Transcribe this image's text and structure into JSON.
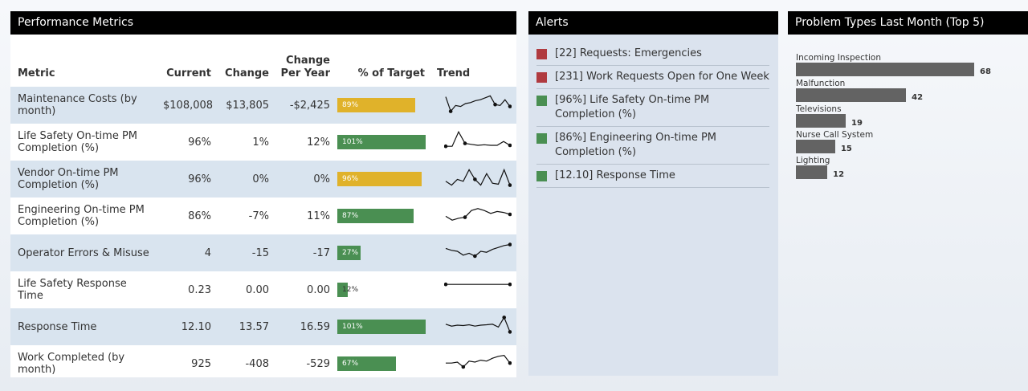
{
  "performance": {
    "title": "Performance Metrics",
    "columns": {
      "metric": "Metric",
      "current": "Current",
      "change": "Change",
      "change_per_year": "Change Per Year",
      "pct_target": "% of Target",
      "trend": "Trend"
    },
    "rows": [
      {
        "metric": "Maintenance Costs (by month)",
        "current": "$108,008",
        "change": "$13,805",
        "change_per_year": "-$2,425",
        "pct_label": "89%",
        "pct_value": 89,
        "bar_color": "#e0b22a",
        "trend": [
          0.15,
          0.9,
          0.6,
          0.65,
          0.5,
          0.45,
          0.35,
          0.3,
          0.2,
          0.1,
          0.55,
          0.6,
          0.3,
          0.65
        ],
        "trend_points": [
          1,
          10,
          13
        ]
      },
      {
        "metric": "Life Safety On-time PM Completion (%)",
        "current": "96%",
        "change": "1%",
        "change_per_year": "12%",
        "pct_label": "101%",
        "pct_value": 101,
        "bar_color": "#4a8f52",
        "trend": [
          0.8,
          0.8,
          0.05,
          0.65,
          0.7,
          0.75,
          0.72,
          0.75,
          0.75,
          0.55,
          0.75
        ],
        "trend_points": [
          0,
          3,
          10
        ]
      },
      {
        "metric": "Vendor On-time PM Completion (%)",
        "current": "96%",
        "change": "0%",
        "change_per_year": "0%",
        "pct_label": "96%",
        "pct_value": 96,
        "bar_color": "#e0b22a",
        "trend": [
          0.7,
          0.9,
          0.6,
          0.7,
          0.1,
          0.6,
          0.9,
          0.3,
          0.8,
          0.85,
          0.1,
          0.9
        ],
        "trend_points": [
          5,
          11
        ]
      },
      {
        "metric": "Engineering On-time PM Completion (%)",
        "current": "86%",
        "change": "-7%",
        "change_per_year": "11%",
        "pct_label": "87%",
        "pct_value": 87,
        "bar_color": "#4a8f52",
        "trend": [
          0.6,
          0.8,
          0.7,
          0.65,
          0.3,
          0.2,
          0.3,
          0.45,
          0.35,
          0.4,
          0.5
        ],
        "trend_points": [
          3,
          10
        ]
      },
      {
        "metric": "Operator Errors & Misuse",
        "current": "4",
        "change": "-15",
        "change_per_year": "-17",
        "pct_label": "27%",
        "pct_value": 27,
        "bar_color": "#4a8f52",
        "trend": [
          0.35,
          0.45,
          0.5,
          0.7,
          0.6,
          0.75,
          0.5,
          0.55,
          0.4,
          0.3,
          0.2,
          0.15
        ],
        "trend_points": [
          5,
          11
        ]
      },
      {
        "metric": "Life Safety Response Time",
        "current": "0.23",
        "change": "0.00",
        "change_per_year": "0.00",
        "pct_label": "12%",
        "pct_value": 12,
        "bar_color": "#4a8f52",
        "trend": [
          0.3,
          0.3,
          0.3,
          0.3,
          0.3,
          0.3,
          0.3,
          0.3,
          0.3,
          0.3
        ],
        "trend_points": [
          0,
          9
        ]
      },
      {
        "metric": "Response Time",
        "current": "12.10",
        "change": "13.57",
        "change_per_year": "16.59",
        "pct_label": "101%",
        "pct_value": 101,
        "bar_color": "#4a8f52",
        "trend": [
          0.45,
          0.55,
          0.5,
          0.52,
          0.48,
          0.55,
          0.5,
          0.48,
          0.45,
          0.6,
          0.1,
          0.85
        ],
        "trend_points": [
          10,
          11
        ]
      },
      {
        "metric": "Work Completed (by month)",
        "current": "925",
        "change": "-408",
        "change_per_year": "-529",
        "pct_label": "67%",
        "pct_value": 67,
        "bar_color": "#4a8f52",
        "trend": [
          0.55,
          0.55,
          0.5,
          0.75,
          0.45,
          0.5,
          0.4,
          0.45,
          0.3,
          0.2,
          0.15,
          0.55
        ],
        "trend_points": [
          3,
          11
        ]
      }
    ]
  },
  "alerts": {
    "title": "Alerts",
    "items": [
      {
        "text": "[22] Requests: Emergencies",
        "color": "#b03a3f"
      },
      {
        "text": "[231] Work Requests Open for One Week",
        "color": "#b03a3f"
      },
      {
        "text": "[96%] Life Safety On-time PM Completion (%)",
        "color": "#4a8f52"
      },
      {
        "text": "[86%] Engineering On-time PM Completion (%)",
        "color": "#4a8f52"
      },
      {
        "text": "[12.10] Response Time",
        "color": "#4a8f52"
      }
    ]
  },
  "problems": {
    "title": "Problem Types Last Month (Top 5)",
    "items": [
      {
        "label": "Incoming Inspection",
        "value": 68
      },
      {
        "label": "Malfunction",
        "value": 42
      },
      {
        "label": "Televisions",
        "value": 19
      },
      {
        "label": "Nurse Call System",
        "value": 15
      },
      {
        "label": "Lighting",
        "value": 12
      }
    ],
    "max": 68
  }
}
